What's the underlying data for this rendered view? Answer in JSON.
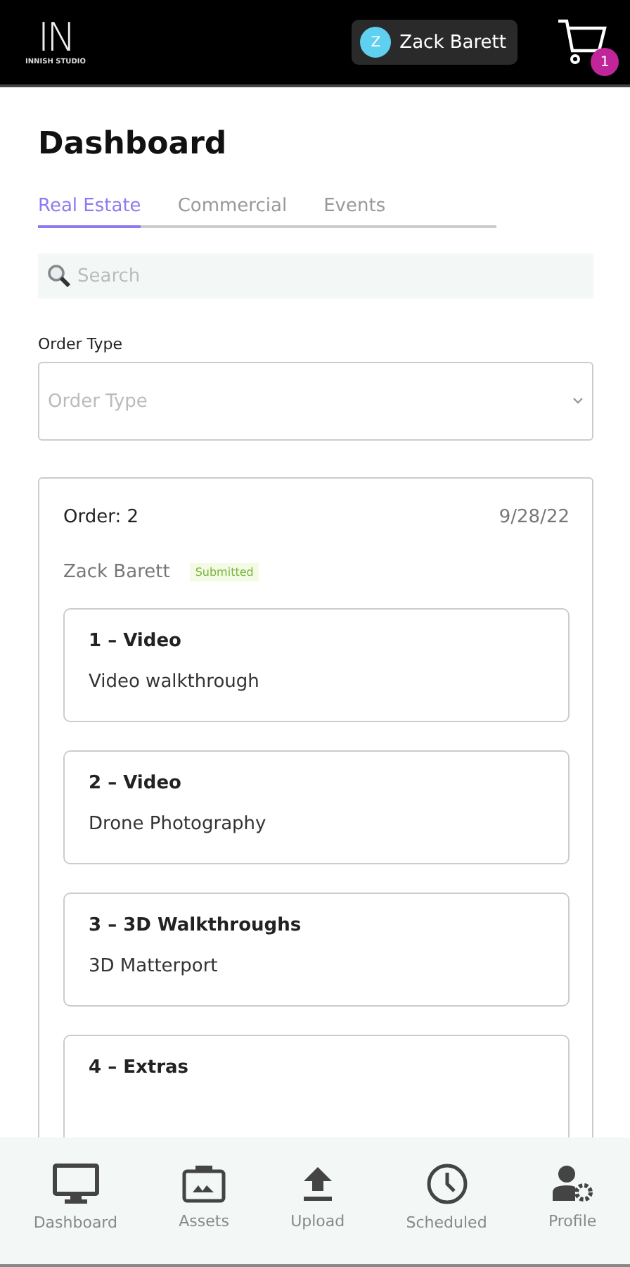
{
  "header": {
    "logo_mark": "IN",
    "logo_text": "INNISH STUDIO",
    "user": {
      "initial": "Z",
      "name": "Zack Barett"
    },
    "cart_count": "1"
  },
  "title": "Dashboard",
  "tabs": [
    {
      "label": "Real Estate",
      "selected": true
    },
    {
      "label": "Commercial",
      "selected": false
    },
    {
      "label": "Events",
      "selected": false
    }
  ],
  "search": {
    "placeholder": "Search"
  },
  "order_type": {
    "label": "Order Type",
    "placeholder": "Order Type"
  },
  "order": {
    "number": "Order: 2",
    "date": "9/28/22",
    "customer": "Zack Barett",
    "status": "Submitted",
    "items": [
      {
        "title": "1 – Video",
        "description": "Video walkthrough"
      },
      {
        "title": "2 – Video",
        "description": "Drone Photography"
      },
      {
        "title": "3 – 3D Walkthroughs",
        "description": "3D Matterport"
      },
      {
        "title": "4 – Extras"
      }
    ]
  },
  "nav": [
    {
      "kind": "monitor",
      "label": "Dashboard"
    },
    {
      "kind": "image",
      "label": "Assets"
    },
    {
      "kind": "upload",
      "label": "Upload"
    },
    {
      "kind": "clock",
      "label": "Scheduled"
    },
    {
      "kind": "profile",
      "label": "Profile"
    }
  ]
}
